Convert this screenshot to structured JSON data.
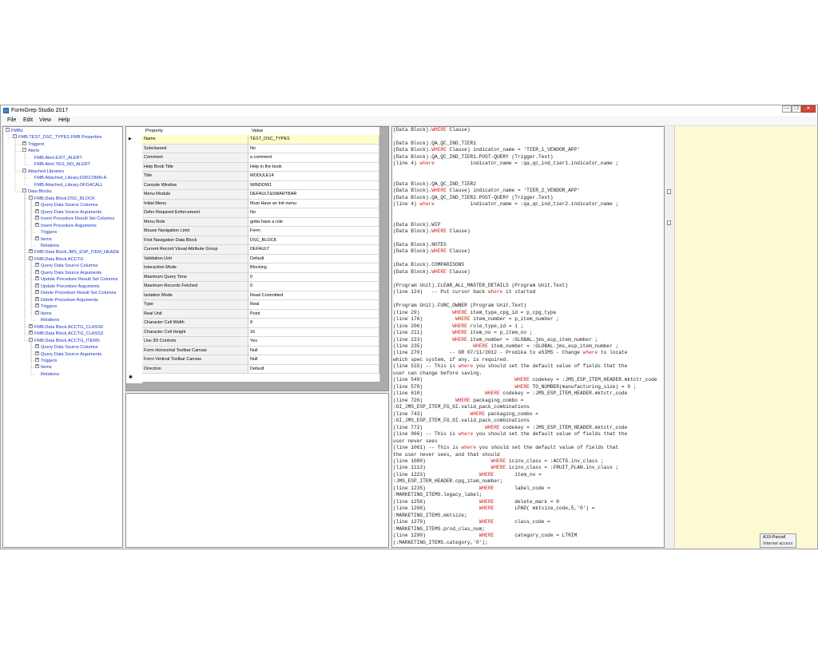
{
  "window": {
    "title": "FormGrep Studio 2017",
    "min_glyph": "—",
    "max_glyph": "❐",
    "close_glyph": "✕"
  },
  "menu": [
    "File",
    "Edit",
    "View",
    "Help"
  ],
  "tree": [
    {
      "label": "FMBs",
      "expander": "-"
    },
    {
      "label": "FMB.TEST_DSC_TYPES.FMB Properties",
      "expander": "-"
    },
    {
      "label": "Triggers",
      "expander": "+"
    },
    {
      "label": "Alerts",
      "expander": "-"
    },
    {
      "label": "FMB.Alert.EXIT_ALERT",
      "expander": ""
    },
    {
      "label": "FMB.Alert.YES_NO_ALERT",
      "expander": ""
    },
    {
      "label": "Attached Libraries",
      "expander": "-"
    },
    {
      "label": "FMB.Attached_Library.D2KCOMN-A",
      "expander": ""
    },
    {
      "label": "FMB.Attached_Library.OFG4CALL",
      "expander": ""
    },
    {
      "label": "Data Blocks",
      "expander": "-"
    },
    {
      "label": "FMB.Data Block.DSC_BLOCK",
      "expander": "-"
    },
    {
      "label": "Query Data Source Columns",
      "expander": "+"
    },
    {
      "label": "Query Data Source Arguments",
      "expander": "+"
    },
    {
      "label": "Insert Procedure Result Set Columns",
      "expander": "+"
    },
    {
      "label": "Insert Procedure Arguments",
      "expander": "+"
    },
    {
      "label": "Triggers",
      "expander": ""
    },
    {
      "label": "Items",
      "expander": "+"
    },
    {
      "label": "Relations",
      "expander": ""
    },
    {
      "label": "FMB.Data Block.JMS_ESP_ITEM_HEADE",
      "expander": "+"
    },
    {
      "label": "FMB.Data Block.ACCTG",
      "expander": "-"
    },
    {
      "label": "Query Data Source Columns",
      "expander": "+"
    },
    {
      "label": "Query Data Source Arguments",
      "expander": "+"
    },
    {
      "label": "Update Procedure Result Set Columns",
      "expander": "+"
    },
    {
      "label": "Update Procedure Arguments",
      "expander": "+"
    },
    {
      "label": "Delete Procedure Result Set Columns",
      "expander": "+"
    },
    {
      "label": "Delete Procedure Arguments",
      "expander": "+"
    },
    {
      "label": "Triggers",
      "expander": "+"
    },
    {
      "label": "Items",
      "expander": "+"
    },
    {
      "label": "Relations",
      "expander": ""
    },
    {
      "label": "FMB.Data Block.ACCTG_CLASS6",
      "expander": "+"
    },
    {
      "label": "FMB.Data Block.ACCTG_CLASS3",
      "expander": "+"
    },
    {
      "label": "FMB.Data Block.ACCTG_ITEMS",
      "expander": "-"
    },
    {
      "label": "Query Data Source Columns",
      "expander": "+"
    },
    {
      "label": "Query Data Source Arguments",
      "expander": "+"
    },
    {
      "label": "Triggers",
      "expander": "+"
    },
    {
      "label": "Items",
      "expander": "+"
    },
    {
      "label": "Relations",
      "expander": ""
    }
  ],
  "grid": {
    "header": {
      "property": "Property",
      "value": "Value"
    },
    "current_row_marker": "▶",
    "new_row_marker": "✱",
    "rows": [
      {
        "p": "Name",
        "v": "TEST_DSC_TYPES"
      },
      {
        "p": "Subclassed",
        "v": "No"
      },
      {
        "p": "Comment",
        "v": "a comment"
      },
      {
        "p": "Help Book Title",
        "v": "Help in the book"
      },
      {
        "p": "Title",
        "v": "MODULE14"
      },
      {
        "p": "Console Window",
        "v": "WINDOW1"
      },
      {
        "p": "Menu Module",
        "v": "DEFAULT&SMARTBAR"
      },
      {
        "p": "Initial Menu",
        "v": "Must Have an Init menu"
      },
      {
        "p": "Defer Required Enforcement",
        "v": "No"
      },
      {
        "p": "Menu Role",
        "v": "gotta have a role"
      },
      {
        "p": "Mouse Navigation Limit",
        "v": "Form"
      },
      {
        "p": "First Navigation Data Block",
        "v": "DSC_BLOCK"
      },
      {
        "p": "Current Record Visual Attribute Group",
        "v": "DEFAULT"
      },
      {
        "p": "Validation Unit",
        "v": "Default"
      },
      {
        "p": "Interaction Mode",
        "v": "Blocking"
      },
      {
        "p": "Maximum Query Time",
        "v": "0"
      },
      {
        "p": "Maximum Records Fetched",
        "v": "0"
      },
      {
        "p": "Isolation Mode",
        "v": "Read Committed"
      },
      {
        "p": "Type",
        "v": "Real"
      },
      {
        "p": "Real Unit",
        "v": "Point"
      },
      {
        "p": "Character Cell Width",
        "v": "8"
      },
      {
        "p": "Character Cell Height",
        "v": "16"
      },
      {
        "p": "Use 3D Controls",
        "v": "Yes"
      },
      {
        "p": "Form Horizontal Toolbar Canvas",
        "v": "Null"
      },
      {
        "p": "Form Vertical Toolbar Canvas",
        "v": "Null"
      },
      {
        "p": "Direction",
        "v": "Default"
      }
    ]
  },
  "code_lines": [
    "(Data Block).WHERE Clause)",
    "",
    "(Data Block).QA_QC_IND_TIER1",
    "(Data Block).WHERE Clause) indicator_name = 'TIER_1_VENDOR_APP'",
    "(Data Block).QA_QC_IND_TIER1.POST-QUERY (Trigger.Text)",
    "(line 4) where            indicator_name = :qa_qc_ind_tier1.indicator_name ;",
    "",
    "",
    "(Data Block).QA_QC_IND_TIER2",
    "(Data Block).WHERE Clause) indicator_name = 'TIER_2_VENDOR_APP'",
    "(Data Block).QA_QC_IND_TIER2.POST-QUERY (Trigger.Text)",
    "(line 4) where            indicator_name = :qa_qc_ind_tier2.indicator_name ;",
    "",
    "",
    "(Data Block).WIP",
    "(Data Block).WHERE Clause)",
    "",
    "(Data Block).NOTES",
    "(Data Block).WHERE Clause)",
    "",
    "(Data Block).COMPARISONS",
    "(Data Block).WHERE Clause)",
    "",
    "(Program Unit).CLEAR_ALL_MASTER_DETAILS (Program Unit.Text)",
    "(line 124)   -- Put cursor back where it started",
    "",
    "(Program Unit).FUNC_OWNER (Program Unit.Text)",
    "(line 29)           WHERE item_type_cpg_id = p_cpg_type",
    "(line 176)           WHERE item_number = p_item_number ;",
    "(line 206)          WHERE role_type_id = 1 ;",
    "(line 211)          WHERE item_no = p_item_no ;",
    "(line 223)          WHERE item_number = :GLOBAL.jms_esp_item_number ;",
    "(line 235)                 WHERE item_number = :GLOBAL.jms_esp_item_number ;",
    "(line 270)         -- GR 07/11/2012 - Prodika to eSIMS - Change where to locate",
    "which spec system, if any, is required.",
    "(line 515) -- This is where you should set the default value of fields that the",
    "user can change before saving.",
    "(line 549)                               WHERE codekey = :JMS_ESP_ITEM_HEADER.mktctr_code",
    "(line 578)                               WHERE TO_NUMBER(manufacturing_size) = 0 ;",
    "(line 610)                     WHERE codekey = :JMS_ESP_ITEM_HEADER.mktctr_code",
    "(line 726)           WHERE packaging_combo =",
    ":GI_JMS_ESP_ITEM_FG_GI.valid_pack_combinations",
    "(line 743)                WHERE packaging_combo =",
    ":GI_JMS_ESP_ITEM_FG_GI.valid_pack_combinations",
    "(line 772)                     WHERE codekey = :JMS_ESP_ITEM_HEADER.mktctr_code",
    "(line 966) -- This is where you should set the default value of fields that the",
    "user never sees",
    "(line 1061) -- This is where you should set the default value of fields that",
    "the user never sees, and that should",
    "(line 1080)                      WHERE icinv_class = :ACCTG.inv_class ;",
    "(line 1113)                      WHERE icinv_class = :FRUIT_PLAN.inv_class ;",
    "(line 1223)                  WHERE       item_no =",
    ":JMS_ESP_ITEM_HEADER.cpg_item_number;",
    "(line 1235)                  WHERE       label_code =",
    ":MARKETING_ITEMS.legacy_label;",
    "(line 1256)                  WHERE       delete_mark = 0",
    "(line 1268)                  WHERE       LPAD( mktsize_code,5,'0') =",
    ":MARKETING_ITEMS.mktsize;",
    "(line 1279)                  WHERE       class_code =",
    ":MARKETING_ITEMS.prod_clas_num;",
    "(line 1290)                  WHERE       category_code = LTRIM",
    "(:MARKETING_ITEMS.category,'0');"
  ],
  "notification": {
    "line1": "A10-Parcell",
    "line2": "Internet access"
  }
}
